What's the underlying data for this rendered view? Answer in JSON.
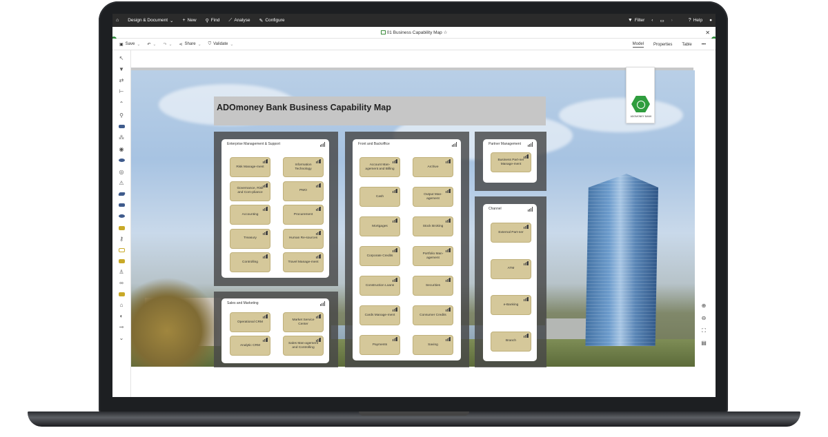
{
  "topnav": {
    "home_icon": "home-icon",
    "design_document": "Design & Document",
    "new": "New",
    "find": "Find",
    "analyse": "Analyse",
    "configure": "Configure",
    "filter": "Filter",
    "help": "Help"
  },
  "titlebar": {
    "title": "01 Business Capability Map ☆"
  },
  "toolbar": {
    "save": "Save",
    "share": "Share",
    "validate": "Validate",
    "views": [
      "Model",
      "Properties",
      "Table"
    ],
    "more": "•••"
  },
  "diagram": {
    "title": "ADOmoney Bank Business Capability Map",
    "logo_caption": "ADOMONEY BANK",
    "groups": {
      "enterprise": {
        "label": "Enterprise Management & Support",
        "caps": [
          "Risk Manage-ment",
          "Information Technology",
          "Governance, Risk and Com-pliance",
          "PMO",
          "Accounting",
          "Procurement",
          "Treasury",
          "Human Re-sources",
          "Controlling",
          "Travel Manage-ment"
        ]
      },
      "sales": {
        "label": "Sales and Marketing",
        "caps": [
          "Operational CRM",
          "Market Service Center",
          "Analytic CRM",
          "Sales Man-agement and Controlling"
        ]
      },
      "front": {
        "label": "Front and Backoffice",
        "caps": [
          "Account Man-agement and Billing",
          "Archive",
          "Cash",
          "Output Man-agement",
          "Mortgages",
          "Stock Broking",
          "Corporate Credits",
          "Portfolio Man-agement",
          "Construction Loans",
          "Securities",
          "Cards Manage-ment",
          "Consumer Credits",
          "Payments",
          "Saving"
        ]
      },
      "partner": {
        "label": "Partner Management",
        "caps": [
          "Business Part-ner Manage-ment"
        ]
      },
      "channel": {
        "label": "Channel",
        "caps": [
          "External Part-ner",
          "ATM",
          "e-Banking",
          "Branch"
        ]
      }
    }
  },
  "colors": {
    "nav_bg": "#2b2b2b",
    "capability_fill": "#d5c89a",
    "group_bg": "#484848",
    "brand_green": "#2f9d3e"
  }
}
